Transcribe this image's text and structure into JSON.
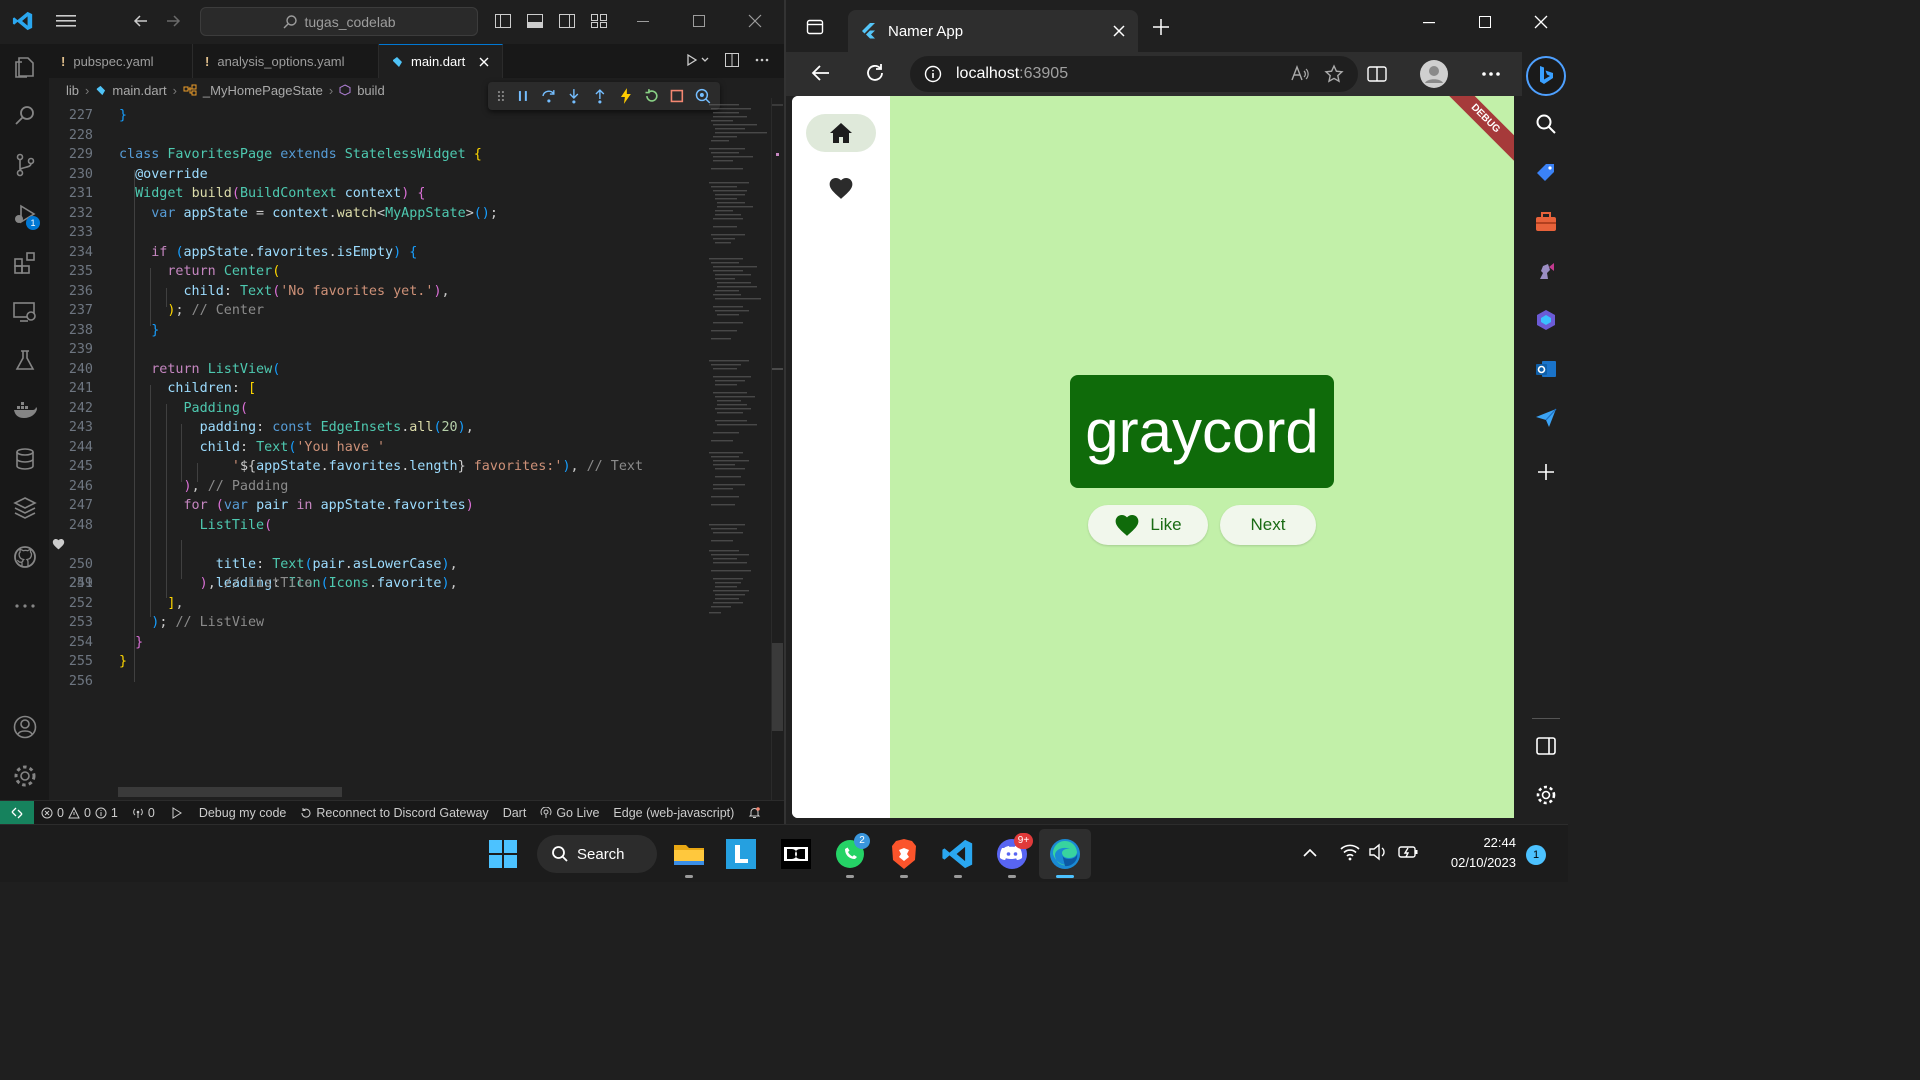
{
  "vscode": {
    "search_text": "tugas_codelab",
    "tabs": [
      {
        "label": "pubspec.yaml",
        "marker": "!"
      },
      {
        "label": "analysis_options.yaml",
        "marker": "!"
      },
      {
        "label": "main.dart",
        "marker": ""
      }
    ],
    "breadcrumb": [
      "lib",
      "main.dart",
      "_MyHomePageState",
      "build"
    ],
    "run_debug_badge": "1",
    "code": [
      {
        "n": "227",
        "t": "}"
      },
      {
        "n": "228",
        "t": ""
      },
      {
        "n": "229",
        "t": "class FavoritesPage extends StatelessWidget {"
      },
      {
        "n": "230",
        "t": "@override"
      },
      {
        "n": "231",
        "t": "Widget build(BuildContext context) {"
      },
      {
        "n": "232",
        "t": "var appState = context.watch<MyAppState>();"
      },
      {
        "n": "233",
        "t": ""
      },
      {
        "n": "234",
        "t": "if (appState.favorites.isEmpty) {"
      },
      {
        "n": "235",
        "t": "return Center("
      },
      {
        "n": "236",
        "t": "child: Text('No favorites yet.'),"
      },
      {
        "n": "237",
        "t": "); // Center"
      },
      {
        "n": "238",
        "t": "}"
      },
      {
        "n": "239",
        "t": ""
      },
      {
        "n": "240",
        "t": "return ListView("
      },
      {
        "n": "241",
        "t": "children: ["
      },
      {
        "n": "242",
        "t": "Padding("
      },
      {
        "n": "243",
        "t": "padding: const EdgeInsets.all(20),"
      },
      {
        "n": "244",
        "t": "child: Text('You have '"
      },
      {
        "n": "245",
        "t": "'${appState.favorites.length} favorites:'), // Text"
      },
      {
        "n": "246",
        "t": "), // Padding"
      },
      {
        "n": "247",
        "t": "for (var pair in appState.favorites)"
      },
      {
        "n": "248",
        "t": "ListTile("
      },
      {
        "n": "249",
        "t": "leading: Icon(Icons.favorite),"
      },
      {
        "n": "250",
        "t": "title: Text(pair.asLowerCase),"
      },
      {
        "n": "251",
        "t": "), // ListTile"
      },
      {
        "n": "252",
        "t": "],"
      },
      {
        "n": "253",
        "t": "); // ListView"
      },
      {
        "n": "254",
        "t": "}"
      },
      {
        "n": "255",
        "t": "}"
      },
      {
        "n": "256",
        "t": ""
      }
    ],
    "status": {
      "problems_errors": "0",
      "problems_warnings": "0",
      "problems_info": "1",
      "ports": "0",
      "debug": "Debug my code",
      "discord": "Reconnect to Discord Gateway",
      "language": "Dart",
      "golive": "Go Live",
      "device": "Edge (web-javascript)"
    }
  },
  "edge": {
    "tab_title": "Namer App",
    "address_host": "localhost",
    "address_port": ":63905",
    "app": {
      "word": "graycord",
      "like_label": "Like",
      "next_label": "Next",
      "debug_banner": "DEBUG"
    }
  },
  "taskbar": {
    "search_label": "Search",
    "whatsapp_badge": "2",
    "discord_badge": "9+",
    "time": "22:44",
    "date": "02/10/2023",
    "notifications": "1"
  },
  "colors": {
    "flutter_bg": "#c2f0a9",
    "word_card": "#0f6b0a",
    "accent": "#0078d4",
    "remote": "#16825d"
  }
}
